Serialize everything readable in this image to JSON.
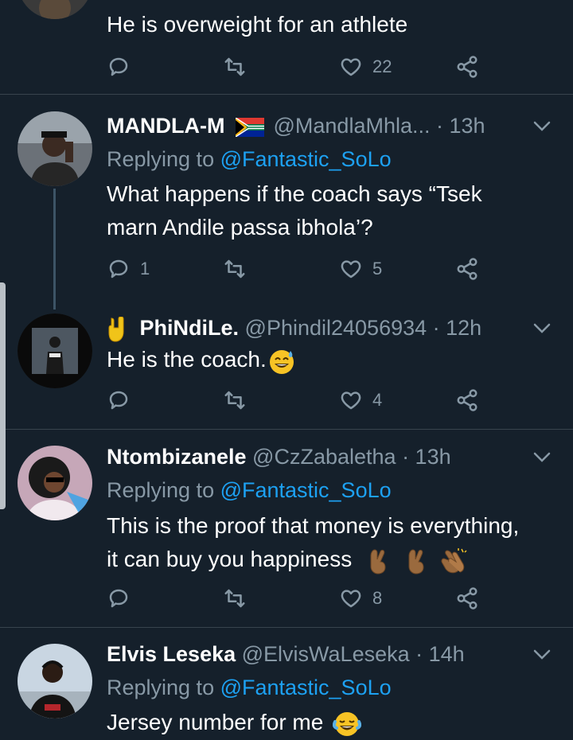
{
  "colors": {
    "background": "#15202b",
    "divider": "#38444d",
    "muted": "#8899a6",
    "link": "#1da1f2",
    "text": "#ffffff"
  },
  "top_tweet": {
    "text": "He is overweight for an athlete",
    "reply_count": "",
    "like_count": "22"
  },
  "tweets": [
    {
      "name": "MANDLA-M",
      "flag": "south-africa-flag-icon",
      "handle": "@MandlaMhla...",
      "time": "· 13h",
      "replying_prefix": "Replying to ",
      "replying_to": "@Fantastic_SoLo",
      "text_lines": [
        "What happens if the coach says “Tsek",
        "marn Andile passa ibhola’?"
      ],
      "reply_count": "1",
      "like_count": "5"
    },
    {
      "name": "PhiNdiLe.",
      "name_emoji": "horns-hand-emoji-icon",
      "handle": "@Phindil24056934",
      "time": "· 12h",
      "text": "He is the coach.",
      "reply_count": "",
      "like_count": "4"
    },
    {
      "name": "Ntombizanele",
      "handle": "@CzZabaletha",
      "time": "· 13h",
      "replying_prefix": "Replying to ",
      "replying_to": "@Fantastic_SoLo",
      "text_lines": [
        "This is the proof that money is everything,",
        "it can buy you happiness"
      ],
      "reply_count": "",
      "like_count": "8"
    },
    {
      "name": "Elvis Leseka",
      "handle": "@ElvisWaLeseka",
      "time": "· 14h",
      "replying_prefix": "Replying to ",
      "replying_to": "@Fantastic_SoLo",
      "text": "Jersey number for me"
    }
  ]
}
